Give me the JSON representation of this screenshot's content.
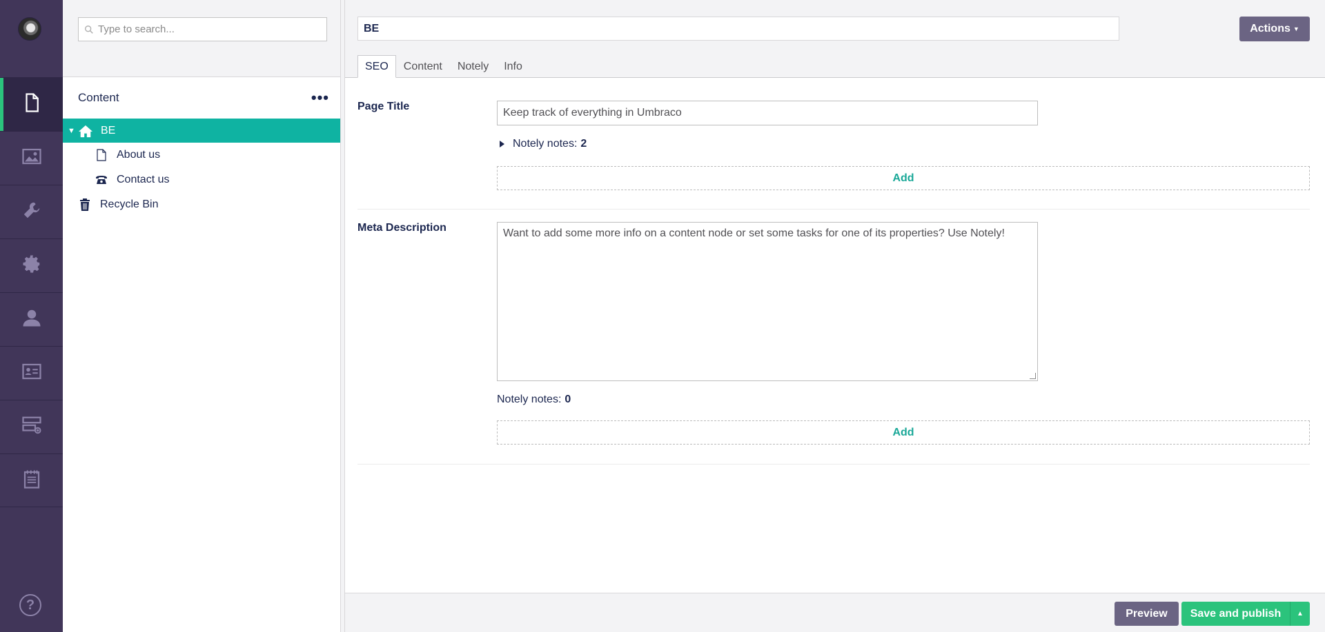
{
  "rail": {
    "sections": [
      {
        "name": "content",
        "icon": "document-icon",
        "active": true
      },
      {
        "name": "media",
        "icon": "image-icon",
        "active": false
      },
      {
        "name": "settings",
        "icon": "wrench-icon",
        "active": false
      },
      {
        "name": "packages",
        "icon": "gear-icon",
        "active": false
      },
      {
        "name": "users",
        "icon": "user-icon",
        "active": false
      },
      {
        "name": "members",
        "icon": "id-card-icon",
        "active": false
      },
      {
        "name": "forms",
        "icon": "forms-icon",
        "active": false
      },
      {
        "name": "notes",
        "icon": "notepad-icon",
        "active": false
      }
    ],
    "help_label": "?"
  },
  "tree": {
    "search_placeholder": "Type to search...",
    "header": "Content",
    "more_label": "•••",
    "root": "BE",
    "children": [
      "About us",
      "Contact us"
    ],
    "recycle_bin": "Recycle Bin"
  },
  "editor": {
    "node_name": "BE",
    "actions_label": "Actions",
    "tabs": [
      "SEO",
      "Content",
      "Notely",
      "Info"
    ],
    "active_tab": "SEO",
    "page_title": {
      "label": "Page Title",
      "value": "Keep track of everything in Umbraco",
      "notes_label": "Notely notes:",
      "notes_count": "2",
      "add_label": "Add"
    },
    "meta_description": {
      "label": "Meta Description",
      "value": "Want to add some more info on a content node or set some tasks for one of its properties? Use Notely!",
      "notes_label": "Notely notes:",
      "notes_count": "0",
      "add_label": "Add"
    }
  },
  "footer": {
    "preview_label": "Preview",
    "save_label": "Save and publish"
  },
  "colors": {
    "rail": "#413659",
    "accent_teal": "#0fb3a2",
    "save_green": "#2bc37c",
    "button_purple": "#6b6483"
  }
}
